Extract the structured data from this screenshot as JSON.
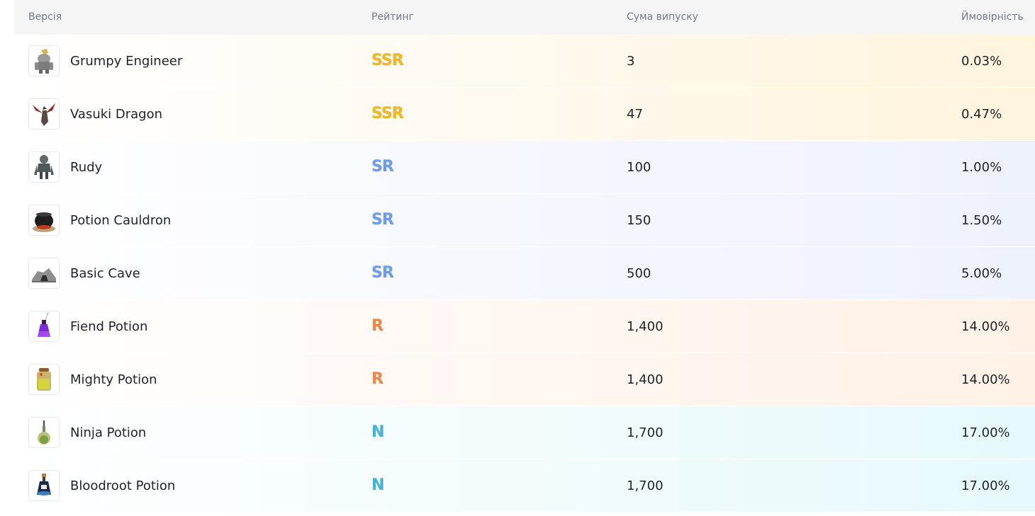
{
  "header": {
    "version": "Версія",
    "rating": "Рейтинг",
    "sum": "Сума випуску",
    "probability": "Ймовірність"
  },
  "rows": [
    {
      "name": "Grumpy Engineer",
      "rating": "SSR",
      "sum": "3",
      "probability": "0.03%",
      "icon": "engineer-icon"
    },
    {
      "name": "Vasuki Dragon",
      "rating": "SSR",
      "sum": "47",
      "probability": "0.47%",
      "icon": "dragon-icon"
    },
    {
      "name": "Rudy",
      "rating": "SR",
      "sum": "100",
      "probability": "1.00%",
      "icon": "creature-icon"
    },
    {
      "name": "Potion Cauldron",
      "rating": "SR",
      "sum": "150",
      "probability": "1.50%",
      "icon": "cauldron-icon"
    },
    {
      "name": "Basic Cave",
      "rating": "SR",
      "sum": "500",
      "probability": "5.00%",
      "icon": "cave-icon"
    },
    {
      "name": "Fiend Potion",
      "rating": "R",
      "sum": "1,400",
      "probability": "14.00%",
      "icon": "purple-potion-icon"
    },
    {
      "name": "Mighty Potion",
      "rating": "R",
      "sum": "1,400",
      "probability": "14.00%",
      "icon": "jar-potion-icon"
    },
    {
      "name": "Ninja Potion",
      "rating": "N",
      "sum": "1,700",
      "probability": "17.00%",
      "icon": "flask-potion-icon"
    },
    {
      "name": "Bloodroot Potion",
      "rating": "N",
      "sum": "1,700",
      "probability": "17.00%",
      "icon": "vial-potion-icon"
    }
  ],
  "colors": {
    "SSR": "#f5b81e",
    "SR": "#6e9ef0",
    "R": "#f0884a",
    "N": "#3fb6e0"
  }
}
